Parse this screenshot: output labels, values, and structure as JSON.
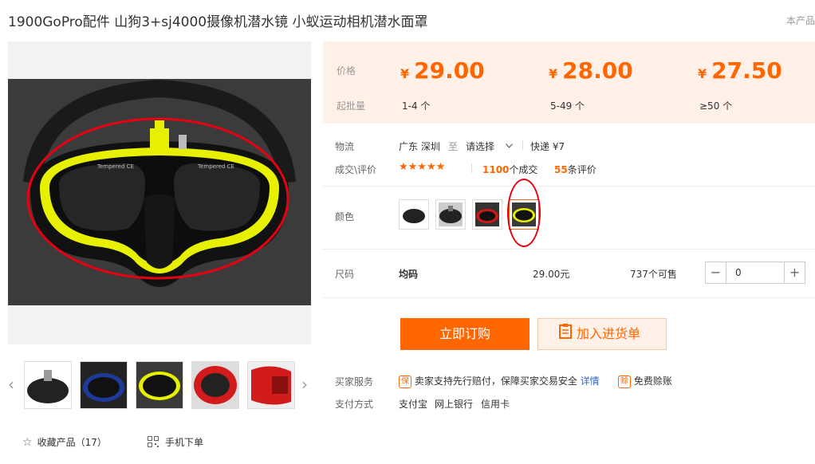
{
  "product": {
    "title": "1900GoPro配件 山狗3+sj4000摄像机潜水镜 小蚁运动相机潜水面罩",
    "corner_text": "本产品"
  },
  "gallery": {
    "mask_text_left": "Tempered CE",
    "mask_text_right": "Tempered CE",
    "prev_arrow": "‹",
    "next_arrow": "›"
  },
  "pricing": {
    "price_label": "价格",
    "moq_label": "起批量",
    "currency": "¥",
    "tiers": [
      {
        "price": "29.00",
        "range": "1-4 个"
      },
      {
        "price": "28.00",
        "range": "5-49 个"
      },
      {
        "price": "27.50",
        "range": "≥50 个"
      }
    ]
  },
  "logistics": {
    "label": "物流",
    "origin": "广东 深圳",
    "to": "至",
    "dest_select": "请选择",
    "shipping": "快递 ¥7"
  },
  "deals": {
    "label": "成交\\评价",
    "rating": 5,
    "deal_count": "1100",
    "deal_suffix": "个成交",
    "review_count": "55",
    "review_suffix": "条评价"
  },
  "color": {
    "label": "颜色",
    "selected_index": 3
  },
  "size": {
    "label": "尺码",
    "value": "均码",
    "price": "29.00元",
    "stock": "737个可售",
    "quantity": "0",
    "minus": "−",
    "plus": "+"
  },
  "actions": {
    "buy_now": "立即订购",
    "add_to_cart": "加入进货单"
  },
  "service": {
    "label": "买家服务",
    "badge1": "保",
    "text1": "卖家支持先行赔付，保障买家交易安全",
    "link1": "详情",
    "badge2": "赊",
    "text2": "免费赊账"
  },
  "payment": {
    "label": "支付方式",
    "methods": [
      "支付宝",
      "网上银行",
      "信用卡"
    ]
  },
  "footer": {
    "favorite": "收藏产品（17）",
    "mobile_order": "手机下单"
  },
  "colors": {
    "accent": "#ff6600",
    "price_bg": "#fff1e8",
    "highlight_red": "#e60012",
    "mask_yellow": "#e6f000"
  }
}
